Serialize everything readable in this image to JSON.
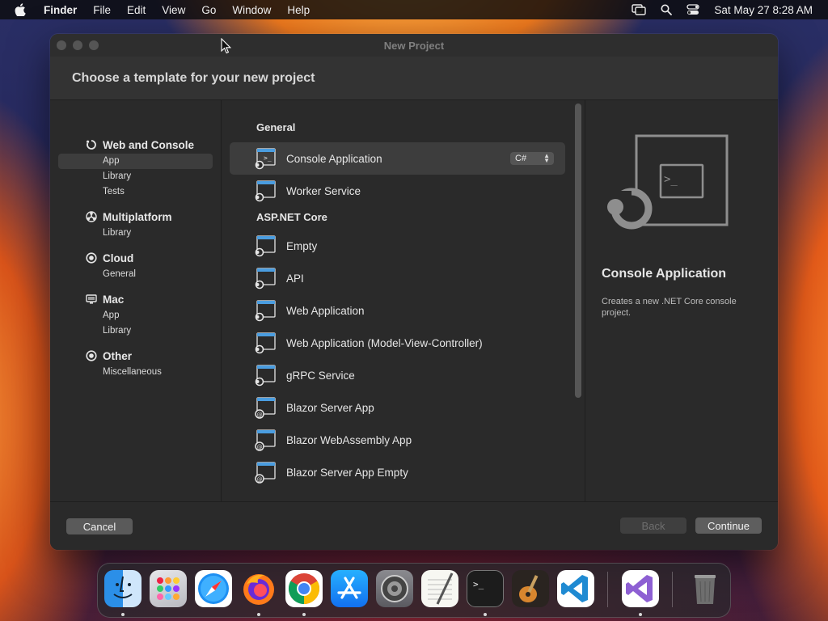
{
  "menubar": {
    "app_name": "Finder",
    "items": [
      "File",
      "Edit",
      "View",
      "Go",
      "Window",
      "Help"
    ],
    "datetime": "Sat May 27  8:28 AM"
  },
  "window": {
    "title": "New Project",
    "header": "Choose a template for your new project"
  },
  "sidebar": {
    "categories": [
      {
        "label": "Web and Console",
        "icon": "refresh-circle-icon",
        "items": [
          "App",
          "Library",
          "Tests"
        ]
      },
      {
        "label": "Multiplatform",
        "icon": "multiplatform-icon",
        "items": [
          "Library"
        ]
      },
      {
        "label": "Cloud",
        "icon": "cloud-target-icon",
        "items": [
          "General"
        ]
      },
      {
        "label": "Mac",
        "icon": "monitor-icon",
        "items": [
          "App",
          "Library"
        ]
      },
      {
        "label": "Other",
        "icon": "target-icon",
        "items": [
          "Miscellaneous"
        ]
      }
    ],
    "selected": "App"
  },
  "templates": {
    "general_title": "General",
    "general": [
      "Console Application",
      "Worker Service"
    ],
    "aspnet_title": "ASP.NET Core",
    "aspnet": [
      "Empty",
      "API",
      "Web Application",
      "Web Application (Model-View-Controller)",
      "gRPC Service",
      "Blazor Server App",
      "Blazor WebAssembly App",
      "Blazor Server App Empty"
    ],
    "selected": "Console Application",
    "language": "C#"
  },
  "detail": {
    "title": "Console Application",
    "description": "Creates a new .NET Core console project."
  },
  "buttons": {
    "cancel": "Cancel",
    "back": "Back",
    "continue": "Continue"
  },
  "dock": {
    "apps": [
      "Finder",
      "Launchpad",
      "Safari",
      "Firefox",
      "Chrome",
      "App Store",
      "System Preferences",
      "TextEdit",
      "Terminal",
      "GarageBand",
      "Visual Studio Code",
      "Visual Studio",
      "Trash"
    ]
  },
  "colors": {
    "window_bg": "#2a2a2a",
    "selection": "#3d3d3d",
    "template_icon_blue": "#4a9de0"
  }
}
